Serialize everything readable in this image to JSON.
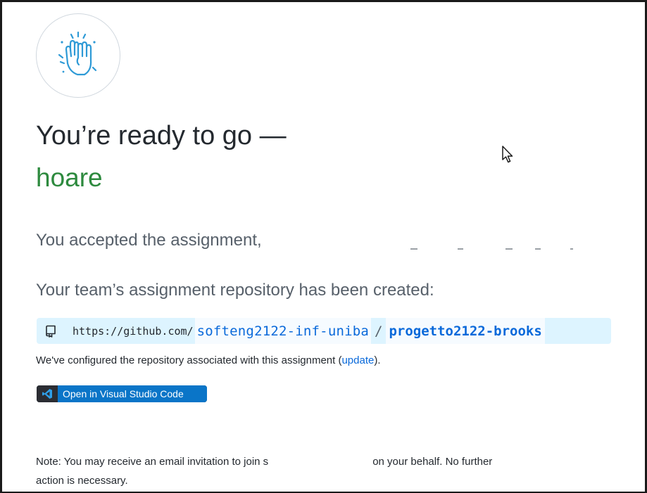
{
  "headline": {
    "title": "You’re ready to go —",
    "team": "hoare"
  },
  "accepted": {
    "text": "You accepted the assignment,"
  },
  "repository": {
    "heading": "Your team’s assignment repository has been created:",
    "url_prefix": "https://github.com/",
    "owner": "softeng2122-inf-uniba",
    "separator": "/",
    "name": "progetto2122-brooks"
  },
  "configured": {
    "text_before": "We've configured the repository associated with this assignment (",
    "link": "update",
    "text_after": ")."
  },
  "vscode_button": {
    "label": "Open in Visual Studio Code"
  },
  "note": {
    "line1_before": "Note: You may receive an email invitation to join s",
    "line1_after": "on your behalf. No further",
    "line2": "action is necessary."
  },
  "colors": {
    "accent_green": "#2d8a3e",
    "link_blue": "#0969da",
    "repo_box_bg": "#ddf4ff",
    "vscode_blue": "#0a75c8"
  },
  "icons": {
    "avatar": "high-five-icon",
    "repo": "repo-icon",
    "vscode": "vscode-icon",
    "cursor": "mouse-pointer-icon"
  }
}
